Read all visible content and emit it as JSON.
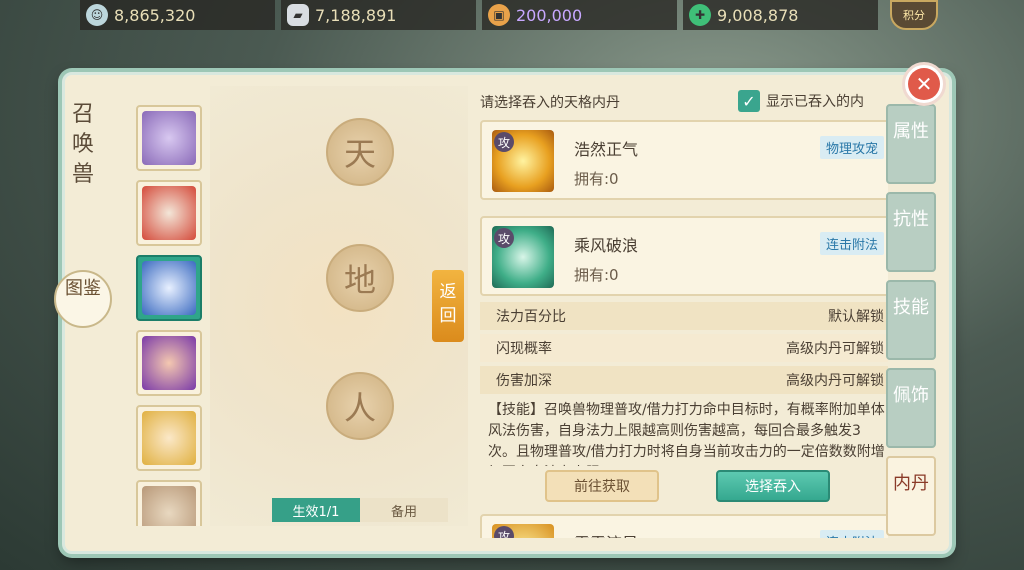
{
  "resources": [
    {
      "icon": "jade-coin-icon",
      "value": "8,865,320",
      "color": "#bcd6dc"
    },
    {
      "icon": "silver-ingot-icon",
      "value": "7,188,891",
      "color": "#d8dde2"
    },
    {
      "icon": "copper-coin-icon",
      "value": "200,000",
      "color": "#e9a24a"
    },
    {
      "icon": "green-money-icon",
      "value": "9,008,878",
      "color": "#3fbf78"
    }
  ],
  "jifen": "积分",
  "side_title": "召唤兽",
  "tujian": "图鉴",
  "pets": [
    {
      "icon": "purple-pet-icon",
      "color": "#8a6ab8"
    },
    {
      "icon": "opera-mask-pet-icon",
      "color": "#d44a3a"
    },
    {
      "icon": "white-tiger-pet-icon",
      "color": "#3a6ac0",
      "selected": true
    },
    {
      "icon": "purple-hair-girl-pet-icon",
      "color": "#7a3aa8"
    },
    {
      "icon": "blonde-girl-pet-icon",
      "color": "#e0b040"
    },
    {
      "icon": "partial-pet-icon",
      "color": "#b89878"
    }
  ],
  "slots": {
    "tian": "天",
    "di": "地",
    "ren": "人"
  },
  "back_label": "返回",
  "tabs": {
    "active": "生效1/1",
    "reserve": "备用"
  },
  "right": {
    "header": "请选择吞入的天格内丹",
    "show_swallowed": "显示已吞入的内",
    "cards": [
      {
        "name": "浩然正气",
        "owned": "拥有:0",
        "tag": "物理攻宠",
        "type": "攻",
        "icon": "golden-energy-icon"
      },
      {
        "name": "乘风破浪",
        "owned": "拥有:0",
        "tag": "连击附法",
        "type": "攻",
        "icon": "green-wave-icon"
      }
    ],
    "attrs": [
      {
        "label": "法力百分比",
        "value": "默认解锁"
      },
      {
        "label": "闪现概率",
        "value": "高级内丹可解锁"
      },
      {
        "label": "伤害加深",
        "value": "高级内丹可解锁"
      }
    ],
    "description": "【技能】召唤兽物理普攻/借力打力命中目标时，有概率附加单体风法伤害，自身法力上限越高则伤害越高，每回合最多触发3次。且物理普攻/借力打力时将自身当前攻击力的一定倍数数附增加至自身法力上限",
    "obtain_btn": "前往获取",
    "swallow_btn": "选择吞入",
    "next_card": {
      "name": "霹雳流星",
      "tag": "连击附法",
      "type": "攻"
    }
  },
  "side_tabs": [
    "属性",
    "抗性",
    "技能",
    "佩饰",
    "内丹"
  ],
  "active_side_tab": "内丹"
}
